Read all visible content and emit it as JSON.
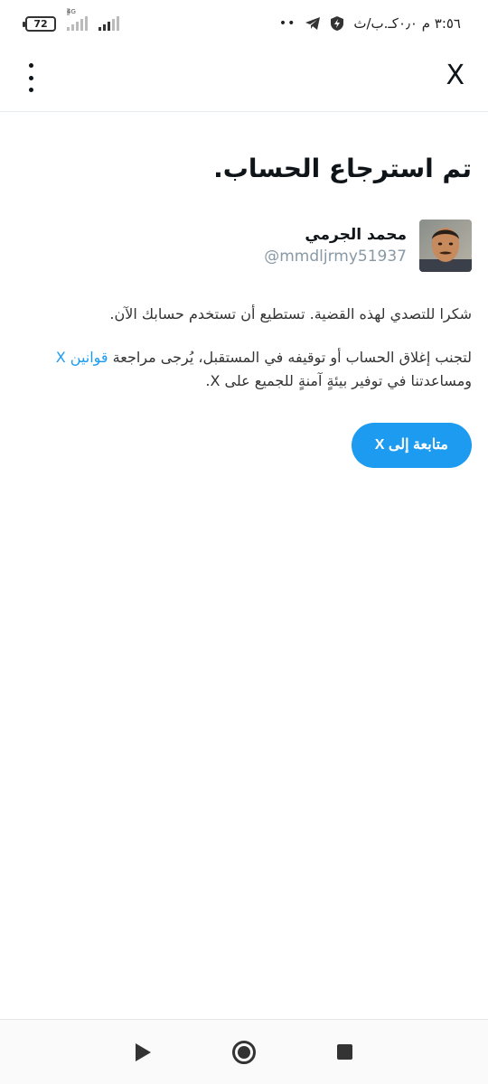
{
  "status_bar": {
    "battery": "72",
    "network": "4G",
    "time": "٣:٥٦ م ٠٫٠كـ.ب/ث",
    "overflow_dots": "••",
    "icons": [
      "telegram-icon",
      "shield-icon"
    ]
  },
  "top_bar": {
    "close_label": "X",
    "menu_icon": "kebab-menu-icon"
  },
  "main": {
    "title": "تم استرجاع الحساب.",
    "user": {
      "name": "محمد الجرمي",
      "handle": "@mmdljrmy51937"
    },
    "paragraph_1": "شكرا للتصدي لهذه القضية. تستطيع أن تستخدم حسابك الآن.",
    "paragraph_2_prefix": "لتجنب إغلاق الحساب أو توقيفه في المستقبل، يُرجى مراجعة ",
    "paragraph_2_link": "قوانين X",
    "paragraph_2_suffix": " ومساعدتنا في توفير بيئةٍ آمنةٍ للجميع على X.",
    "continue_button": "متابعة إلى X"
  },
  "colors": {
    "accent": "#1d9bf0",
    "text": "#0f1419",
    "muted": "#8899a6"
  },
  "nav_bar": {
    "icons": [
      "play-icon",
      "home-circle-icon",
      "stop-square-icon"
    ]
  }
}
